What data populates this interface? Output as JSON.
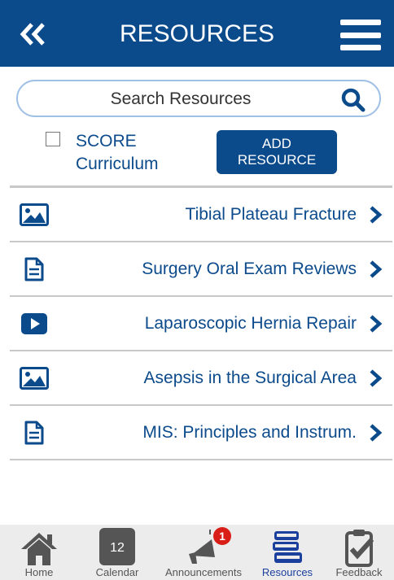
{
  "header": {
    "title": "RESOURCES"
  },
  "search": {
    "placeholder": "Search Resources"
  },
  "filter": {
    "score_label": "SCORE Curriculum",
    "add_label": "ADD RESOURCE"
  },
  "resources": [
    {
      "title": "Tibial Plateau Fracture",
      "icon": "image-icon"
    },
    {
      "title": "Surgery Oral Exam Reviews",
      "icon": "document-icon"
    },
    {
      "title": "Laparoscopic Hernia Repair",
      "icon": "video-icon"
    },
    {
      "title": "Asepsis in the Surgical Area",
      "icon": "image-icon"
    },
    {
      "title": "MIS: Principles and Instrum.",
      "icon": "document-icon"
    }
  ],
  "tabs": [
    {
      "label": "Home",
      "icon": "home-icon"
    },
    {
      "label": "Calendar",
      "icon": "calendar-icon",
      "day": "12"
    },
    {
      "label": "Announcements",
      "icon": "megaphone-icon",
      "badge": "1"
    },
    {
      "label": "Resources",
      "icon": "books-icon",
      "active": true
    },
    {
      "label": "Feedback",
      "icon": "clipboard-check-icon"
    }
  ],
  "colors": {
    "brand": "#0b4a8b",
    "active_tab": "#1a3f9c",
    "badge": "#d91e18"
  }
}
